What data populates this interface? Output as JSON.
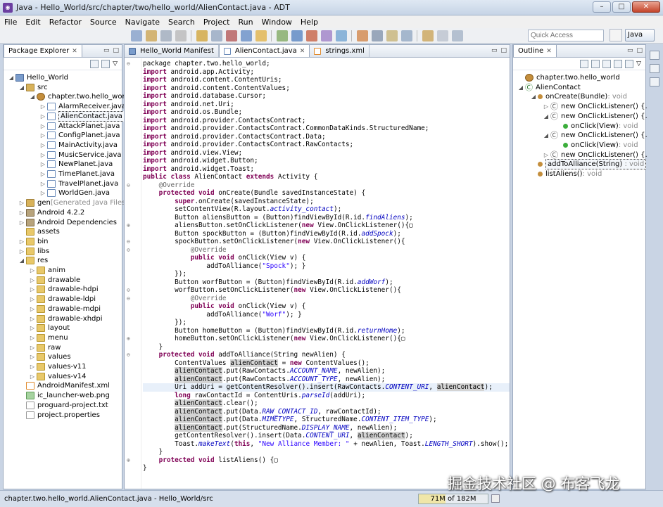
{
  "window": {
    "title": "Java - Hello_World/src/chapter/two/hello_world/AlienContact.java - ADT",
    "app_icon": "eclipse-icon"
  },
  "menu": [
    "File",
    "Edit",
    "Refactor",
    "Source",
    "Navigate",
    "Search",
    "Project",
    "Run",
    "Window",
    "Help"
  ],
  "toolbar": {
    "quick_access_placeholder": "Quick Access",
    "perspective": "Java"
  },
  "package_explorer": {
    "tab": "Package Explorer",
    "tree": [
      {
        "label": "Hello_World",
        "depth": 0,
        "icon": "proj",
        "twisty": "open"
      },
      {
        "label": "src",
        "depth": 1,
        "icon": "srcf",
        "twisty": "open"
      },
      {
        "label": "chapter.two.hello_world",
        "depth": 2,
        "icon": "pkg",
        "twisty": "open"
      },
      {
        "label": "AlarmReceiver.java",
        "depth": 3,
        "icon": "jfile",
        "twisty": "closed"
      },
      {
        "label": "AlienContact.java",
        "depth": 3,
        "icon": "jfile",
        "twisty": "closed",
        "selected": true
      },
      {
        "label": "AttackPlanet.java",
        "depth": 3,
        "icon": "jfile",
        "twisty": "closed"
      },
      {
        "label": "ConfigPlanet.java",
        "depth": 3,
        "icon": "jfile",
        "twisty": "closed"
      },
      {
        "label": "MainActivity.java",
        "depth": 3,
        "icon": "jfile",
        "twisty": "closed"
      },
      {
        "label": "MusicService.java",
        "depth": 3,
        "icon": "jfile",
        "twisty": "closed"
      },
      {
        "label": "NewPlanet.java",
        "depth": 3,
        "icon": "jfile",
        "twisty": "closed"
      },
      {
        "label": "TimePlanet.java",
        "depth": 3,
        "icon": "jfile",
        "twisty": "closed"
      },
      {
        "label": "TravelPlanet.java",
        "depth": 3,
        "icon": "jfile",
        "twisty": "closed"
      },
      {
        "label": "WorldGen.java",
        "depth": 3,
        "icon": "jfile",
        "twisty": "closed"
      },
      {
        "label": "gen",
        "suffix": "[Generated Java Files]",
        "depth": 1,
        "icon": "srcf",
        "twisty": "closed"
      },
      {
        "label": "Android 4.2.2",
        "depth": 1,
        "icon": "lib",
        "twisty": "closed"
      },
      {
        "label": "Android Dependencies",
        "depth": 1,
        "icon": "lib",
        "twisty": "closed"
      },
      {
        "label": "assets",
        "depth": 1,
        "icon": "folder",
        "twisty": "none"
      },
      {
        "label": "bin",
        "depth": 1,
        "icon": "folder",
        "twisty": "closed"
      },
      {
        "label": "libs",
        "depth": 1,
        "icon": "folder",
        "twisty": "closed"
      },
      {
        "label": "res",
        "depth": 1,
        "icon": "folder",
        "twisty": "open"
      },
      {
        "label": "anim",
        "depth": 2,
        "icon": "folder",
        "twisty": "closed"
      },
      {
        "label": "drawable",
        "depth": 2,
        "icon": "folder",
        "twisty": "closed"
      },
      {
        "label": "drawable-hdpi",
        "depth": 2,
        "icon": "folder",
        "twisty": "closed"
      },
      {
        "label": "drawable-ldpi",
        "depth": 2,
        "icon": "folder",
        "twisty": "closed"
      },
      {
        "label": "drawable-mdpi",
        "depth": 2,
        "icon": "folder",
        "twisty": "closed"
      },
      {
        "label": "drawable-xhdpi",
        "depth": 2,
        "icon": "folder",
        "twisty": "closed"
      },
      {
        "label": "layout",
        "depth": 2,
        "icon": "folder",
        "twisty": "closed"
      },
      {
        "label": "menu",
        "depth": 2,
        "icon": "folder",
        "twisty": "closed"
      },
      {
        "label": "raw",
        "depth": 2,
        "icon": "folder",
        "twisty": "closed"
      },
      {
        "label": "values",
        "depth": 2,
        "icon": "folder",
        "twisty": "closed"
      },
      {
        "label": "values-v11",
        "depth": 2,
        "icon": "folder",
        "twisty": "closed"
      },
      {
        "label": "values-v14",
        "depth": 2,
        "icon": "folder",
        "twisty": "closed"
      },
      {
        "label": "AndroidManifest.xml",
        "depth": 1,
        "icon": "xml",
        "twisty": "none"
      },
      {
        "label": "ic_launcher-web.png",
        "depth": 1,
        "icon": "img",
        "twisty": "none"
      },
      {
        "label": "proguard-project.txt",
        "depth": 1,
        "icon": "txt",
        "twisty": "none"
      },
      {
        "label": "project.properties",
        "depth": 1,
        "icon": "txt",
        "twisty": "none"
      }
    ]
  },
  "editor": {
    "tabs": [
      {
        "label": "Hello_World Manifest",
        "active": false
      },
      {
        "label": "AlienContact.java",
        "active": true
      },
      {
        "label": "strings.xml",
        "active": false
      }
    ],
    "lines": [
      {
        "g": "⊖",
        "t": "package chapter.two.hello_world;"
      },
      {
        "t": "<k>import</k> android.app.Activity;"
      },
      {
        "t": "<k>import</k> android.content.ContentUris;"
      },
      {
        "t": "<k>import</k> android.content.ContentValues;"
      },
      {
        "t": "<k>import</k> android.database.Cursor;"
      },
      {
        "t": "<k>import</k> android.net.Uri;"
      },
      {
        "t": "<k>import</k> android.os.Bundle;"
      },
      {
        "t": "<k>import</k> android.provider.ContactsContract;"
      },
      {
        "t": "<k>import</k> android.provider.ContactsContract.CommonDataKinds.StructuredName;"
      },
      {
        "t": "<k>import</k> android.provider.ContactsContract.Data;"
      },
      {
        "t": "<k>import</k> android.provider.ContactsContract.RawContacts;"
      },
      {
        "t": "<k>import</k> android.view.View;"
      },
      {
        "t": "<k>import</k> android.widget.Button;"
      },
      {
        "t": "<k>import</k> android.widget.Toast;"
      },
      {
        "t": "<k>public class</k> AlienContact <k>extends</k> Activity {"
      },
      {
        "g": "⊖",
        "t": "    <a>@Override</a>"
      },
      {
        "t": "    <k>protected void</k> onCreate(Bundle savedInstanceState) {"
      },
      {
        "t": "        <k>super</k>.onCreate(savedInstanceState);"
      },
      {
        "t": "        setContentView(R.layout.<i>activity_contact</i>);"
      },
      {
        "t": "        Button aliensButton = (Button)findViewById(R.id.<i>findAliens</i>);"
      },
      {
        "g": "⊕",
        "t": "        aliensButton.setOnClickListener(<k>new</k> View.OnClickListener(){▢"
      },
      {
        "t": "        Button spockButton = (Button)findViewById(R.id.<i>addSpock</i>);"
      },
      {
        "g": "⊖",
        "t": "        spockButton.setOnClickListener(<k>new</k> View.OnClickListener(){"
      },
      {
        "g": "⊖",
        "t": "            <a>@Override</a>"
      },
      {
        "t": "            <k>public void</k> onClick(View v) {"
      },
      {
        "t": "                addToAlliance(<s>\"Spock\"</s>); }"
      },
      {
        "t": "        });"
      },
      {
        "t": "        Button worfButton = (Button)findViewById(R.id.<i>addWorf</i>);"
      },
      {
        "g": "⊖",
        "t": "        worfButton.setOnClickListener(<k>new</k> View.OnClickListener(){"
      },
      {
        "g": "⊖",
        "t": "            <a>@Override</a>"
      },
      {
        "t": "            <k>public void</k> onClick(View v) {"
      },
      {
        "t": "                addToAlliance(<s>\"Worf\"</s>); }"
      },
      {
        "t": "        });"
      },
      {
        "t": "        Button homeButton = (Button)findViewById(R.id.<i>returnHome</i>);"
      },
      {
        "g": "⊕",
        "t": "        homeButton.setOnClickListener(<k>new</k> View.OnClickListener(){▢"
      },
      {
        "t": "    }"
      },
      {
        "g": "⊖",
        "t": "    <k>protected void</k> addToAlliance(String newAlien) {"
      },
      {
        "t": "        ContentValues <h>alienContact</h> = <k>new</k> ContentValues();"
      },
      {
        "t": "        <h>alienContact</h>.put(RawContacts.<i>ACCOUNT_NAME</i>, newAlien);"
      },
      {
        "t": "        <h>alienContact</h>.put(RawContacts.<i>ACCOUNT_TYPE</i>, newAlien);"
      },
      {
        "t": "        Uri addUri = getContentResolver().insert(RawContacts.<i>CONTENT_URI</i>, <h>alienContact</h>);",
        "cur": true
      },
      {
        "t": "        <k>long</k> rawContactId = ContentUris.<i>parseId</i>(addUri);"
      },
      {
        "t": "        <h>alienContact</h>.clear();"
      },
      {
        "t": "        <h>alienContact</h>.put(Data.<i>RAW_CONTACT_ID</i>, rawContactId);"
      },
      {
        "t": "        <h>alienContact</h>.put(Data.<i>MIMETYPE</i>, StructuredName.<i>CONTENT_ITEM_TYPE</i>);"
      },
      {
        "t": "        <h>alienContact</h>.put(StructuredName.<i>DISPLAY_NAME</i>, newAlien);"
      },
      {
        "t": "        getContentResolver().insert(Data.<i>CONTENT_URI</i>, <h>alienContact</h>);"
      },
      {
        "t": "        Toast.<i>makeText</i>(<k>this</k>, <s>\"New Alliance Member: \"</s> + newAlien, Toast.<i>LENGTH_SHORT</i>).show();"
      },
      {
        "t": "    }"
      },
      {
        "g": "⊕",
        "t": "    <k>protected void</k> listAliens() {▢"
      },
      {
        "t": "}"
      }
    ]
  },
  "outline": {
    "tab": "Outline",
    "items": [
      {
        "label": "chapter.two.hello_world",
        "depth": 0,
        "kind": "pkg",
        "twisty": "none"
      },
      {
        "label": "AlienContact",
        "depth": 0,
        "kind": "class",
        "twisty": "open"
      },
      {
        "label": "onCreate(Bundle)",
        "ret": " : void",
        "depth": 1,
        "kind": "meth",
        "twisty": "open"
      },
      {
        "label": "new OnClickListener() {...}",
        "depth": 2,
        "kind": "anon",
        "twisty": "closed"
      },
      {
        "label": "new OnClickListener() {...}",
        "depth": 2,
        "kind": "anon",
        "twisty": "open"
      },
      {
        "label": "onClick(View)",
        "ret": " : void",
        "depth": 3,
        "kind": "meth",
        "twisty": "none"
      },
      {
        "label": "new OnClickListener() {...}",
        "depth": 2,
        "kind": "anon",
        "twisty": "open"
      },
      {
        "label": "onClick(View)",
        "ret": " : void",
        "depth": 3,
        "kind": "meth",
        "twisty": "none"
      },
      {
        "label": "new OnClickListener() {...}",
        "depth": 2,
        "kind": "anon",
        "twisty": "closed"
      },
      {
        "label": "addToAlliance(String)",
        "ret": " : void",
        "depth": 1,
        "kind": "meth",
        "twisty": "none",
        "selected": true
      },
      {
        "label": "listAliens()",
        "ret": " : void",
        "depth": 1,
        "kind": "meth",
        "twisty": "none"
      }
    ]
  },
  "status": {
    "text": "chapter.two.hello_world.AlienContact.java - Hello_World/src",
    "memory": "71M of 182M",
    "memory_used_fraction": 0.39
  },
  "watermark": "掘金技术社区 @ 布客飞龙"
}
